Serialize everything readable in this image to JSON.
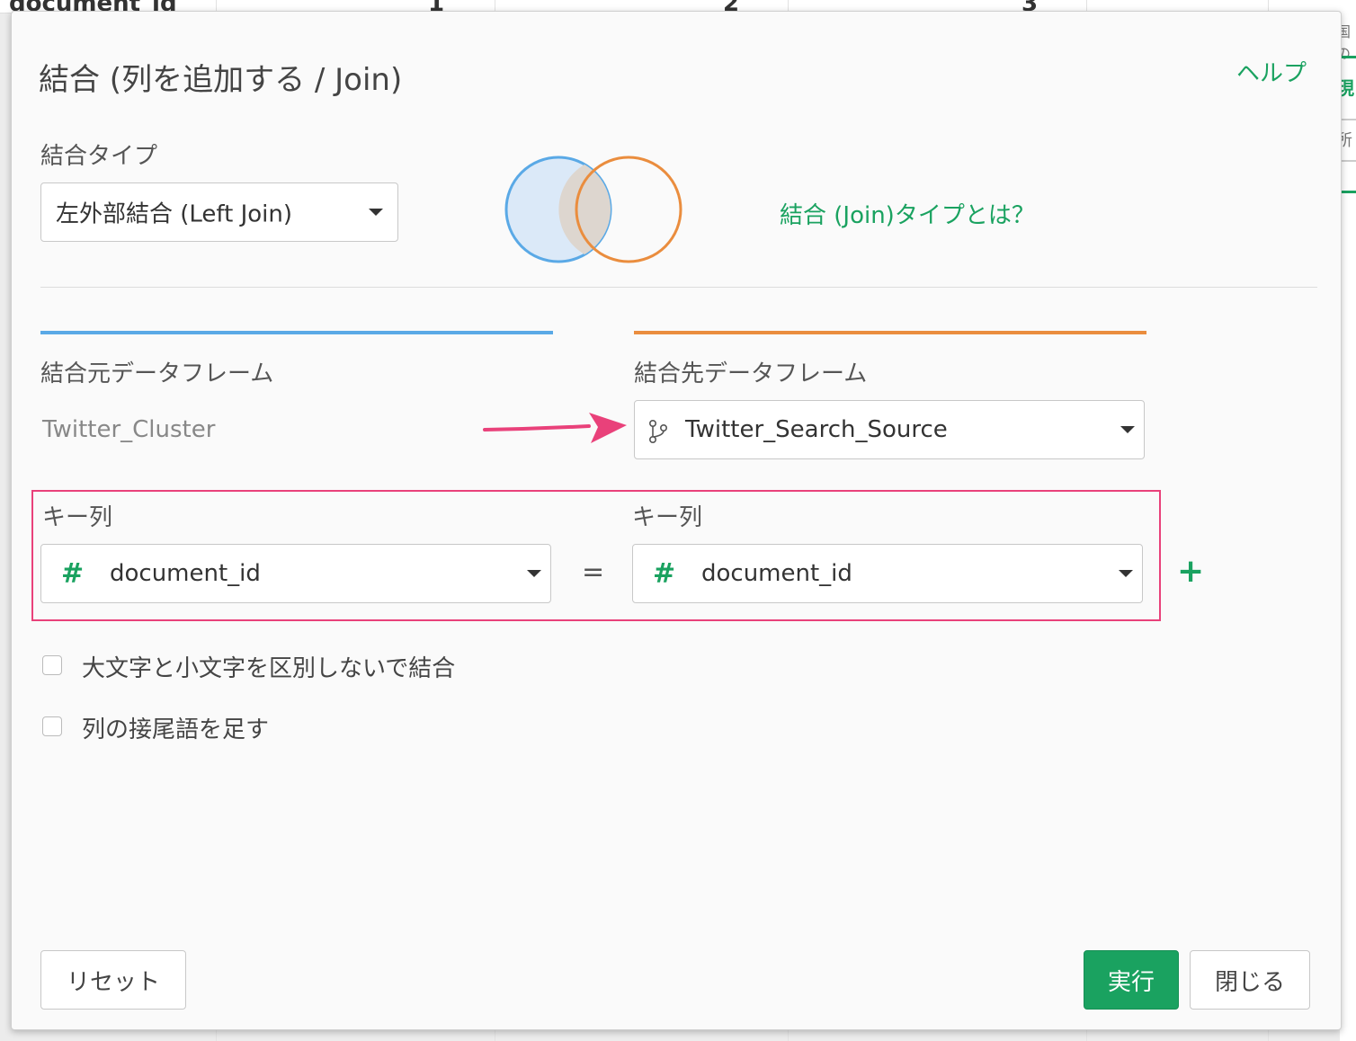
{
  "background": {
    "columns": [
      "document_id",
      "1",
      "2",
      "3"
    ],
    "side_text_1": "現",
    "side_text_2": "所",
    "side_text_top": "国の"
  },
  "dialog": {
    "title": "結合 (列を追加する / Join)",
    "help_label": "ヘルプ",
    "join_type": {
      "label": "結合タイプ",
      "selected": "左外部結合 (Left Join)",
      "help_link": "結合 (Join)タイプとは？"
    },
    "source": {
      "label": "結合元データフレーム",
      "name": "Twitter_Cluster"
    },
    "target": {
      "label": "結合先データフレーム",
      "selected": "Twitter_Search_Source"
    },
    "keys": {
      "left_label": "キー列",
      "right_label": "キー列",
      "left_column": "document_id",
      "right_column": "document_id",
      "column_type_icon": "#",
      "equals": "=",
      "add_label": "+"
    },
    "options": {
      "ignore_case": "大文字と小文字を区別しないで結合",
      "add_suffix": "列の接尾語を足す"
    },
    "buttons": {
      "reset": "リセット",
      "run": "実行",
      "close": "閉じる"
    }
  },
  "colors": {
    "accent": "#1aa260",
    "source_blue": "#5aa9e6",
    "target_orange": "#ea8d3e",
    "highlight_pink": "#e9417a"
  }
}
